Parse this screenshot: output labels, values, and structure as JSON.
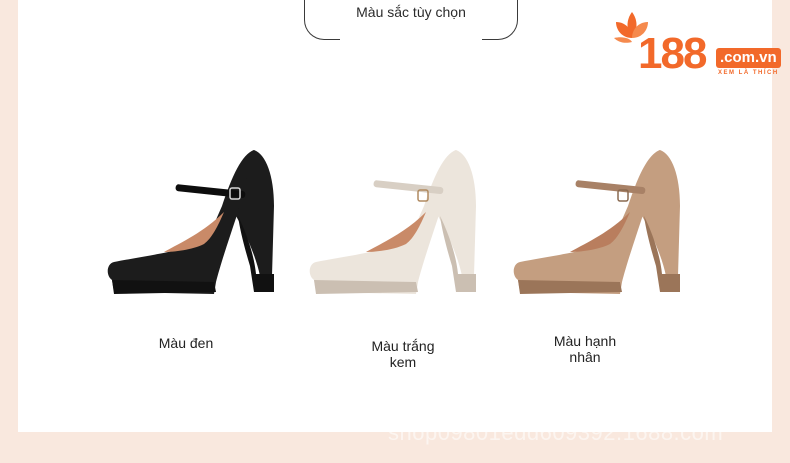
{
  "header": {
    "title": "Màu sắc tùy chọn"
  },
  "logo": {
    "number": "188",
    "domain": ".com.vn",
    "tagline": "XEM LÀ THÍCH"
  },
  "products": [
    {
      "label": "Màu đen",
      "color": "#1c1c1c",
      "shade": "#0d0d0d",
      "sole": "#111111"
    },
    {
      "label": "Màu trắng kem",
      "color": "#ece5dc",
      "shade": "#d8cfc4",
      "sole": "#cbbfb2"
    },
    {
      "label": "Màu hạnh nhân",
      "color": "#c49e80",
      "shade": "#a88166",
      "sole": "#9b7559"
    }
  ],
  "watermark": "shop09801edd609392.1688.com"
}
